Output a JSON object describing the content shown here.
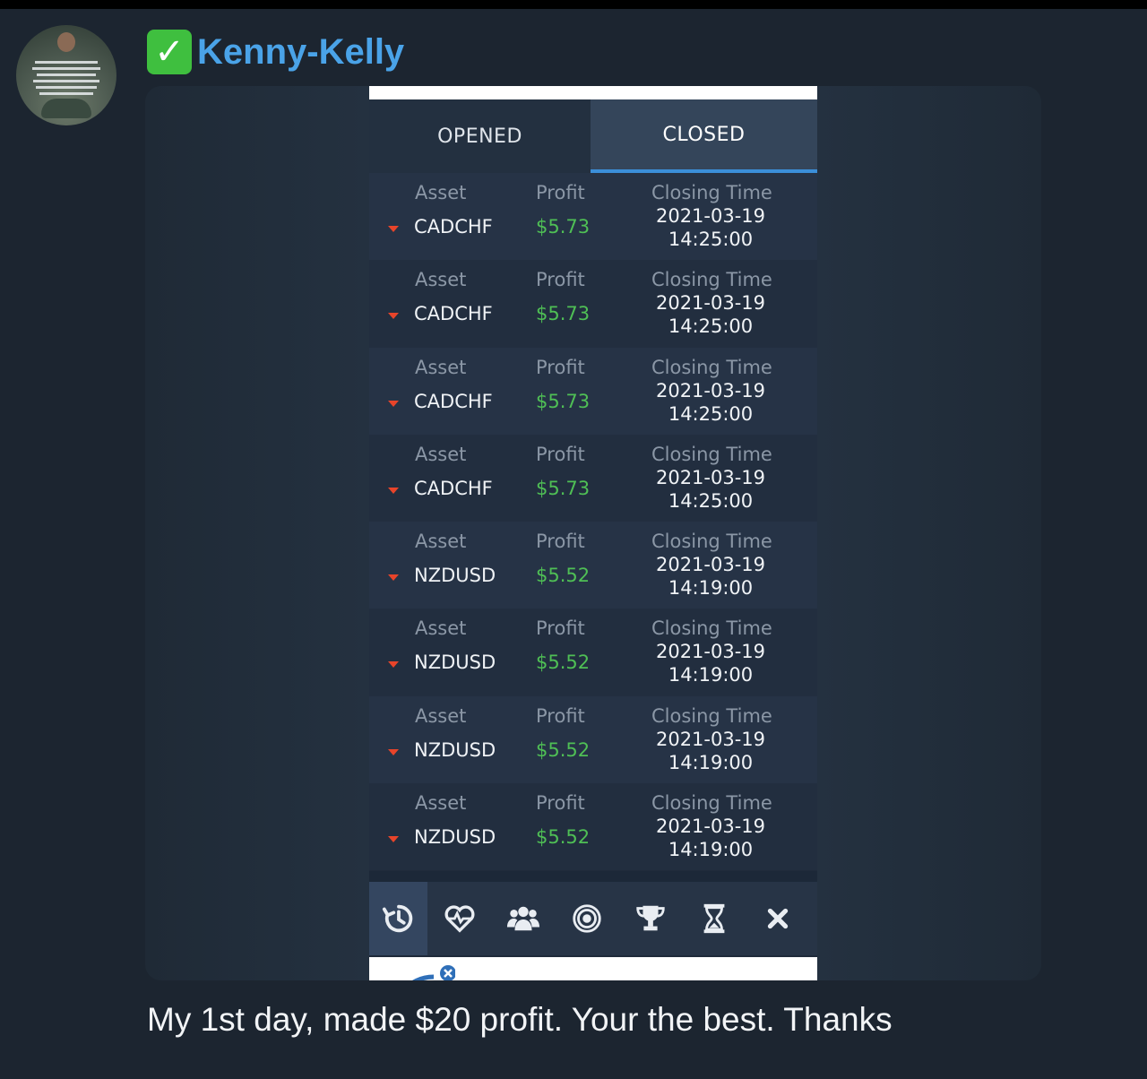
{
  "sender": {
    "badge": "✓",
    "name": "Kenny-Kelly"
  },
  "screenshot": {
    "tabs": [
      {
        "label": "OPENED",
        "active": false
      },
      {
        "label": "CLOSED",
        "active": true
      }
    ],
    "column_labels": {
      "asset": "Asset",
      "profit": "Profit",
      "closing_time": "Closing Time"
    },
    "trades": [
      {
        "asset": "CADCHF",
        "profit": "$5.73",
        "date": "2021-03-19",
        "time": "14:25:00",
        "direction": "down"
      },
      {
        "asset": "CADCHF",
        "profit": "$5.73",
        "date": "2021-03-19",
        "time": "14:25:00",
        "direction": "down"
      },
      {
        "asset": "CADCHF",
        "profit": "$5.73",
        "date": "2021-03-19",
        "time": "14:25:00",
        "direction": "down"
      },
      {
        "asset": "CADCHF",
        "profit": "$5.73",
        "date": "2021-03-19",
        "time": "14:25:00",
        "direction": "down"
      },
      {
        "asset": "NZDUSD",
        "profit": "$5.52",
        "date": "2021-03-19",
        "time": "14:19:00",
        "direction": "down"
      },
      {
        "asset": "NZDUSD",
        "profit": "$5.52",
        "date": "2021-03-19",
        "time": "14:19:00",
        "direction": "down"
      },
      {
        "asset": "NZDUSD",
        "profit": "$5.52",
        "date": "2021-03-19",
        "time": "14:19:00",
        "direction": "down"
      },
      {
        "asset": "NZDUSD",
        "profit": "$5.52",
        "date": "2021-03-19",
        "time": "14:19:00",
        "direction": "down"
      }
    ],
    "toolbar_icons": [
      "history-icon",
      "pulse-heart-icon",
      "group-icon",
      "target-icon",
      "trophy-icon",
      "hourglass-icon",
      "close-icon"
    ]
  },
  "message": {
    "text": "My 1st day, made $20 profit.  Your the best. Thanks"
  },
  "colors": {
    "background": "#1c2530",
    "sender_name": "#4aa3e8",
    "profit": "#4fbf55",
    "down_arrow": "#e8442a",
    "tab_underline": "#3b8fd9"
  }
}
